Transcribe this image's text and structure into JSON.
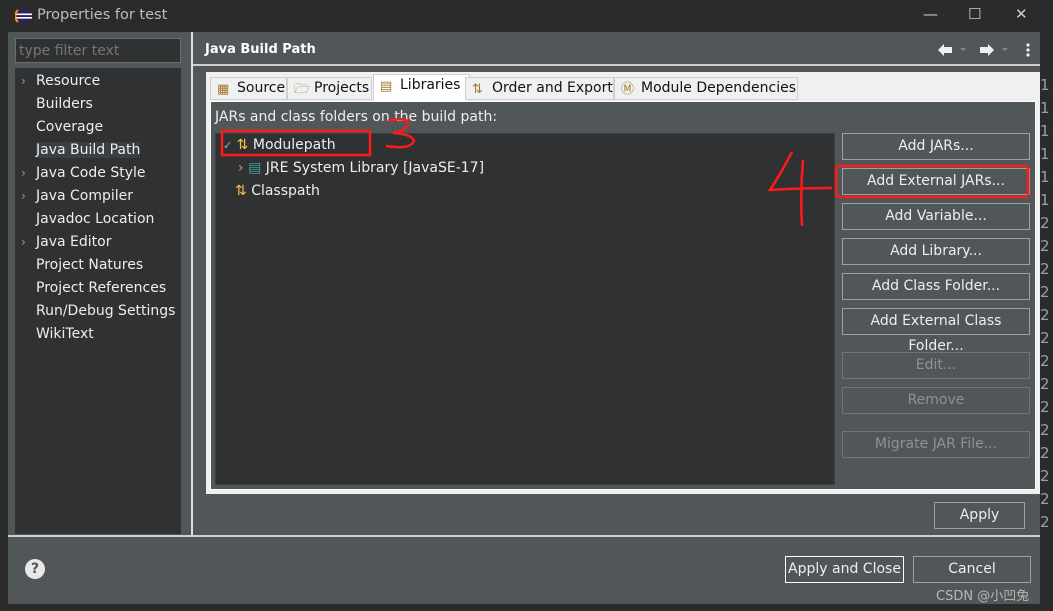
{
  "window": {
    "title": "Properties for test",
    "minimize": "—",
    "maximize": "☐",
    "close": "✕"
  },
  "sidebar": {
    "filter_placeholder": "type filter text",
    "items": [
      {
        "label": "Resource",
        "expandable": true
      },
      {
        "label": "Builders",
        "expandable": false
      },
      {
        "label": "Coverage",
        "expandable": false
      },
      {
        "label": "Java Build Path",
        "expandable": false,
        "selected": true
      },
      {
        "label": "Java Code Style",
        "expandable": true
      },
      {
        "label": "Java Compiler",
        "expandable": true
      },
      {
        "label": "Javadoc Location",
        "expandable": false
      },
      {
        "label": "Java Editor",
        "expandable": true
      },
      {
        "label": "Project Natures",
        "expandable": false
      },
      {
        "label": "Project References",
        "expandable": false
      },
      {
        "label": "Run/Debug Settings",
        "expandable": false
      },
      {
        "label": "WikiText",
        "expandable": false
      }
    ]
  },
  "header": {
    "title": "Java Build Path",
    "back_icon": "arrow-left-icon",
    "forward_icon": "arrow-right-icon",
    "menu_icon": "kebab-menu-icon"
  },
  "tabs": [
    {
      "label": "Source",
      "icon": "source-icon"
    },
    {
      "label": "Projects",
      "icon": "folder-icon"
    },
    {
      "label": "Libraries",
      "icon": "library-icon",
      "active": true
    },
    {
      "label": "Order and Export",
      "icon": "order-icon"
    },
    {
      "label": "Module Dependencies",
      "icon": "module-icon"
    }
  ],
  "libraries": {
    "label": "JARs and class folders on the build path:",
    "tree": [
      {
        "label": "Modulepath",
        "expanded": true
      },
      {
        "label": "JRE System Library [JavaSE-17]"
      },
      {
        "label": "Classpath"
      }
    ],
    "buttons": [
      {
        "label": "Add JARs...",
        "enabled": true
      },
      {
        "label": "Add External JARs...",
        "enabled": true
      },
      {
        "label": "Add Variable...",
        "enabled": true
      },
      {
        "label": "Add Library...",
        "enabled": true
      },
      {
        "label": "Add Class Folder...",
        "enabled": true
      },
      {
        "label": "Add External Class Folder...",
        "enabled": true
      },
      {
        "label": "Edit...",
        "enabled": false
      },
      {
        "label": "Remove",
        "enabled": false
      },
      {
        "label": "Migrate JAR File...",
        "enabled": false
      }
    ]
  },
  "footer": {
    "apply": "Apply",
    "apply_and_close": "Apply and Close",
    "cancel": "Cancel",
    "help": "?"
  },
  "annotations": {
    "step3": "3",
    "step4": "4",
    "color": "#ff1a1a"
  },
  "background_editor_numbers": [
    "1",
    "1",
    "1",
    "1",
    "1",
    "1",
    "2",
    "2",
    "2",
    "2",
    "2",
    "2",
    "2",
    "2",
    "2",
    "2",
    "2",
    "2",
    "2",
    "2"
  ],
  "watermark": "CSDN @小凹兔"
}
